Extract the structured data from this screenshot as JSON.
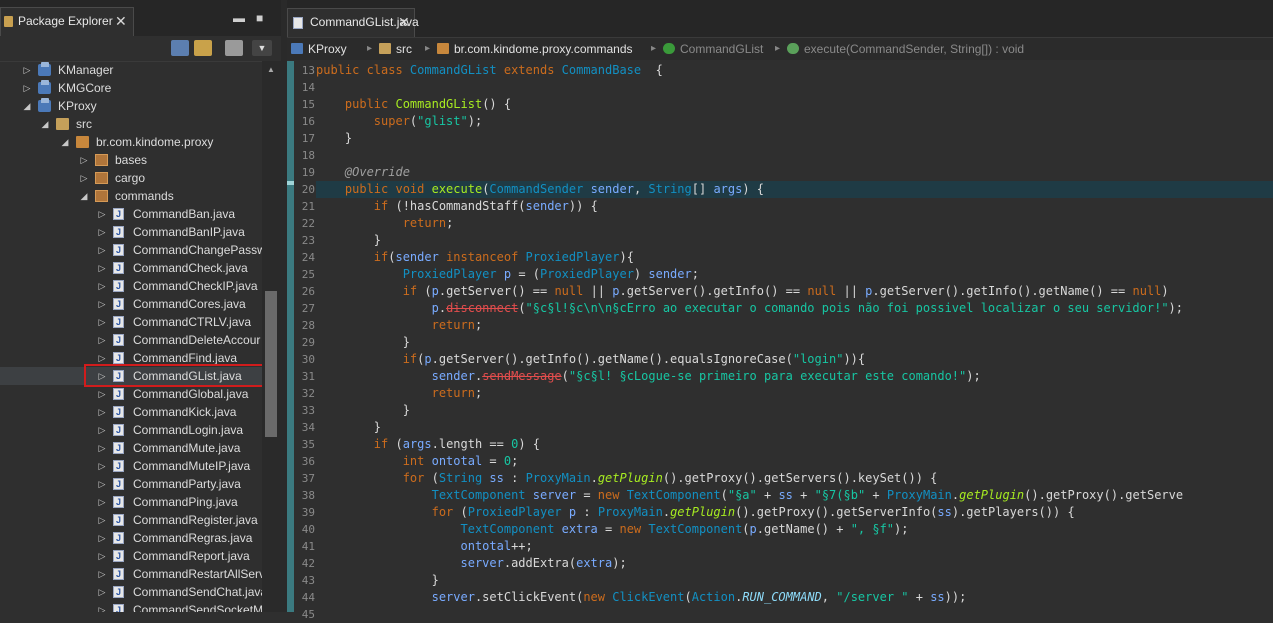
{
  "explorer": {
    "title": "Package Explorer",
    "close_symbol": "✕",
    "minimize_symbol": "▬",
    "maximize_symbol": "■",
    "toolbar": [
      "collapse-all-icon",
      "link-editor-icon",
      "focus-icon",
      "view-menu-icon"
    ],
    "tree": [
      {
        "label": "KManager",
        "level": 0,
        "state": "collapsed",
        "icon": "project-icon"
      },
      {
        "label": "KMGCore",
        "level": 0,
        "state": "collapsed",
        "icon": "project-icon"
      },
      {
        "label": "KProxy",
        "level": 0,
        "state": "expanded",
        "icon": "project-icon"
      },
      {
        "label": "src",
        "level": 1,
        "state": "expanded",
        "icon": "source-folder-icon"
      },
      {
        "label": "br.com.kindome.proxy",
        "level": 2,
        "state": "expanded",
        "icon": "package-icon"
      },
      {
        "label": "bases",
        "level": 3,
        "state": "collapsed",
        "icon": "package-icon"
      },
      {
        "label": "cargo",
        "level": 3,
        "state": "collapsed",
        "icon": "package-icon"
      },
      {
        "label": "commands",
        "level": 3,
        "state": "expanded",
        "icon": "package-icon"
      },
      {
        "label": "CommandBan.java",
        "level": 4,
        "state": "collapsed",
        "icon": "java-file-icon"
      },
      {
        "label": "CommandBanIP.java",
        "level": 4,
        "state": "collapsed",
        "icon": "java-file-icon"
      },
      {
        "label": "CommandChangePassw",
        "level": 4,
        "state": "collapsed",
        "icon": "java-file-icon"
      },
      {
        "label": "CommandCheck.java",
        "level": 4,
        "state": "collapsed",
        "icon": "java-file-icon"
      },
      {
        "label": "CommandCheckIP.java",
        "level": 4,
        "state": "collapsed",
        "icon": "java-file-icon"
      },
      {
        "label": "CommandCores.java",
        "level": 4,
        "state": "collapsed",
        "icon": "java-file-icon"
      },
      {
        "label": "CommandCTRLV.java",
        "level": 4,
        "state": "collapsed",
        "icon": "java-file-icon"
      },
      {
        "label": "CommandDeleteAccour",
        "level": 4,
        "state": "collapsed",
        "icon": "java-file-icon"
      },
      {
        "label": "CommandFind.java",
        "level": 4,
        "state": "collapsed",
        "icon": "java-file-icon"
      },
      {
        "label": "CommandGList.java",
        "level": 4,
        "state": "collapsed",
        "icon": "java-file-icon",
        "selected": true
      },
      {
        "label": "CommandGlobal.java",
        "level": 4,
        "state": "collapsed",
        "icon": "java-file-icon"
      },
      {
        "label": "CommandKick.java",
        "level": 4,
        "state": "collapsed",
        "icon": "java-file-icon"
      },
      {
        "label": "CommandLogin.java",
        "level": 4,
        "state": "collapsed",
        "icon": "java-file-icon"
      },
      {
        "label": "CommandMute.java",
        "level": 4,
        "state": "collapsed",
        "icon": "java-file-icon"
      },
      {
        "label": "CommandMuteIP.java",
        "level": 4,
        "state": "collapsed",
        "icon": "java-file-icon"
      },
      {
        "label": "CommandParty.java",
        "level": 4,
        "state": "collapsed",
        "icon": "java-file-icon"
      },
      {
        "label": "CommandPing.java",
        "level": 4,
        "state": "collapsed",
        "icon": "java-file-icon"
      },
      {
        "label": "CommandRegister.java",
        "level": 4,
        "state": "collapsed",
        "icon": "java-file-icon"
      },
      {
        "label": "CommandRegras.java",
        "level": 4,
        "state": "collapsed",
        "icon": "java-file-icon"
      },
      {
        "label": "CommandReport.java",
        "level": 4,
        "state": "collapsed",
        "icon": "java-file-icon"
      },
      {
        "label": "CommandRestartAllServ",
        "level": 4,
        "state": "collapsed",
        "icon": "java-file-icon"
      },
      {
        "label": "CommandSendChat.java",
        "level": 4,
        "state": "collapsed",
        "icon": "java-file-icon"
      },
      {
        "label": "CommandSendSocketM",
        "level": 4,
        "state": "collapsed",
        "icon": "java-file-icon"
      }
    ]
  },
  "editor": {
    "tab_label": "CommandGList.java",
    "close_symbol": "✕",
    "breadcrumb": [
      {
        "label": "KProxy",
        "icon": "project-icon"
      },
      {
        "label": "src",
        "icon": "source-folder-icon"
      },
      {
        "label": "br.com.kindome.proxy.commands",
        "icon": "package-icon"
      },
      {
        "label": "CommandGList",
        "icon": "class-icon"
      },
      {
        "label": "execute(CommandSender, String[]) : void",
        "icon": "method-icon"
      }
    ],
    "current_line": 20,
    "lines": [
      {
        "n": 13,
        "tokens": [
          [
            "kw",
            "public class "
          ],
          [
            "ty",
            "CommandGList "
          ],
          [
            "kw",
            "extends "
          ],
          [
            "ty",
            "CommandBase"
          ],
          [
            "",
            "  {"
          ]
        ]
      },
      {
        "n": 14,
        "tokens": []
      },
      {
        "n": 15,
        "tokens": [
          [
            "",
            "    "
          ],
          [
            "kw",
            "public "
          ],
          [
            "fn",
            "CommandGList"
          ],
          [
            "",
            "() {"
          ]
        ]
      },
      {
        "n": 16,
        "tokens": [
          [
            "",
            "        "
          ],
          [
            "kw",
            "super"
          ],
          [
            "",
            "("
          ],
          [
            "st",
            "\"glist\""
          ],
          [
            "",
            ");"
          ]
        ]
      },
      {
        "n": 17,
        "tokens": [
          [
            "",
            "    }"
          ]
        ]
      },
      {
        "n": 18,
        "tokens": []
      },
      {
        "n": 19,
        "tokens": [
          [
            "",
            "    "
          ],
          [
            "an",
            "@Override"
          ]
        ]
      },
      {
        "n": 20,
        "tokens": [
          [
            "",
            "    "
          ],
          [
            "kw",
            "public void "
          ],
          [
            "fn",
            "execute"
          ],
          [
            "",
            "("
          ],
          [
            "ty",
            "CommandSender "
          ],
          [
            "va",
            "sender"
          ],
          [
            "",
            ", "
          ],
          [
            "ty",
            "String"
          ],
          [
            "",
            "[] "
          ],
          [
            "va",
            "args"
          ],
          [
            "",
            ") {"
          ]
        ]
      },
      {
        "n": 21,
        "tokens": [
          [
            "",
            "        "
          ],
          [
            "kw",
            "if "
          ],
          [
            "",
            "(!hasCommandStaff("
          ],
          [
            "va",
            "sender"
          ],
          [
            "",
            ")) {"
          ]
        ]
      },
      {
        "n": 22,
        "tokens": [
          [
            "",
            "            "
          ],
          [
            "kw",
            "return"
          ],
          [
            "",
            ";"
          ]
        ]
      },
      {
        "n": 23,
        "tokens": [
          [
            "",
            "        }"
          ]
        ]
      },
      {
        "n": 24,
        "tokens": [
          [
            "",
            "        "
          ],
          [
            "kw",
            "if"
          ],
          [
            "",
            "("
          ],
          [
            "va",
            "sender "
          ],
          [
            "kw",
            "instanceof "
          ],
          [
            "ty",
            "ProxiedPlayer"
          ],
          [
            "",
            "){"
          ]
        ]
      },
      {
        "n": 25,
        "tokens": [
          [
            "",
            "            "
          ],
          [
            "ty",
            "ProxiedPlayer "
          ],
          [
            "va",
            "p"
          ],
          [
            "",
            " = ("
          ],
          [
            "ty",
            "ProxiedPlayer"
          ],
          [
            "",
            ") "
          ],
          [
            "va",
            "sender"
          ],
          [
            "",
            ";"
          ]
        ]
      },
      {
        "n": 26,
        "tokens": [
          [
            "",
            "            "
          ],
          [
            "kw",
            "if "
          ],
          [
            "",
            "("
          ],
          [
            "va",
            "p"
          ],
          [
            "",
            ".getServer() == "
          ],
          [
            "kw",
            "null"
          ],
          [
            "",
            " || "
          ],
          [
            "va",
            "p"
          ],
          [
            "",
            ".getServer().getInfo() == "
          ],
          [
            "kw",
            "null"
          ],
          [
            "",
            " || "
          ],
          [
            "va",
            "p"
          ],
          [
            "",
            ".getServer().getInfo().getName() == "
          ],
          [
            "kw",
            "null"
          ],
          [
            "",
            ")"
          ]
        ]
      },
      {
        "n": 27,
        "tokens": [
          [
            "",
            "                "
          ],
          [
            "va",
            "p"
          ],
          [
            "",
            "."
          ],
          [
            "de",
            "disconnect"
          ],
          [
            "",
            "("
          ],
          [
            "st",
            "\"§c§l!§c\\n\\n§cErro ao executar o comando pois não foi possivel localizar o seu servidor!\""
          ],
          [
            "",
            ");"
          ]
        ]
      },
      {
        "n": 28,
        "tokens": [
          [
            "",
            "                "
          ],
          [
            "kw",
            "return"
          ],
          [
            "",
            ";"
          ]
        ]
      },
      {
        "n": 29,
        "tokens": [
          [
            "",
            "            }"
          ]
        ]
      },
      {
        "n": 30,
        "tokens": [
          [
            "",
            "            "
          ],
          [
            "kw",
            "if"
          ],
          [
            "",
            "("
          ],
          [
            "va",
            "p"
          ],
          [
            "",
            ".getServer().getInfo().getName().equalsIgnoreCase("
          ],
          [
            "st",
            "\"login\""
          ],
          [
            "",
            "))"
          ],
          [
            "",
            "{"
          ]
        ]
      },
      {
        "n": 31,
        "tokens": [
          [
            "",
            "                "
          ],
          [
            "va",
            "sender"
          ],
          [
            "",
            "."
          ],
          [
            "de",
            "sendMessage"
          ],
          [
            "",
            "("
          ],
          [
            "st",
            "\"§c§l! §cLogue-se primeiro para executar este comando!\""
          ],
          [
            "",
            ");"
          ]
        ]
      },
      {
        "n": 32,
        "tokens": [
          [
            "",
            "                "
          ],
          [
            "kw",
            "return"
          ],
          [
            "",
            ";"
          ]
        ]
      },
      {
        "n": 33,
        "tokens": [
          [
            "",
            "            }"
          ]
        ]
      },
      {
        "n": 34,
        "tokens": [
          [
            "",
            "        }"
          ]
        ]
      },
      {
        "n": 35,
        "tokens": [
          [
            "",
            "        "
          ],
          [
            "kw",
            "if "
          ],
          [
            "",
            "("
          ],
          [
            "va",
            "args"
          ],
          [
            "",
            ".length == "
          ],
          [
            "st",
            "0"
          ],
          [
            "",
            ") {"
          ]
        ]
      },
      {
        "n": 36,
        "tokens": [
          [
            "",
            "            "
          ],
          [
            "kw",
            "int "
          ],
          [
            "va",
            "ontotal"
          ],
          [
            "",
            " = "
          ],
          [
            "st",
            "0"
          ],
          [
            "",
            ";"
          ]
        ]
      },
      {
        "n": 37,
        "tokens": [
          [
            "",
            "            "
          ],
          [
            "kw",
            "for "
          ],
          [
            "",
            "("
          ],
          [
            "ty",
            "String "
          ],
          [
            "va",
            "ss"
          ],
          [
            "",
            " : "
          ],
          [
            "ty",
            "ProxyMain"
          ],
          [
            "",
            "."
          ],
          [
            "it",
            "getPlugin"
          ],
          [
            "",
            "().getProxy().getServers().keySet()) {"
          ]
        ]
      },
      {
        "n": 38,
        "tokens": [
          [
            "",
            "                "
          ],
          [
            "ty",
            "TextComponent "
          ],
          [
            "va",
            "server"
          ],
          [
            "",
            " = "
          ],
          [
            "kw",
            "new "
          ],
          [
            "ty",
            "TextComponent"
          ],
          [
            "",
            "("
          ],
          [
            "st",
            "\"§a\""
          ],
          [
            "",
            " + "
          ],
          [
            "va",
            "ss"
          ],
          [
            "",
            " + "
          ],
          [
            "st",
            "\"§7(§b\""
          ],
          [
            "",
            " + "
          ],
          [
            "ty",
            "ProxyMain"
          ],
          [
            "",
            "."
          ],
          [
            "it",
            "getPlugin"
          ],
          [
            "",
            "().getProxy().getServe"
          ]
        ]
      },
      {
        "n": 39,
        "tokens": [
          [
            "",
            "                "
          ],
          [
            "kw",
            "for "
          ],
          [
            "",
            "("
          ],
          [
            "ty",
            "ProxiedPlayer "
          ],
          [
            "va",
            "p"
          ],
          [
            "",
            " : "
          ],
          [
            "ty",
            "ProxyMain"
          ],
          [
            "",
            "."
          ],
          [
            "it",
            "getPlugin"
          ],
          [
            "",
            "().getProxy().getServerInfo("
          ],
          [
            "va",
            "ss"
          ],
          [
            "",
            ").getPlayers()) {"
          ]
        ]
      },
      {
        "n": 40,
        "tokens": [
          [
            "",
            "                    "
          ],
          [
            "ty",
            "TextComponent "
          ],
          [
            "va",
            "extra"
          ],
          [
            "",
            " = "
          ],
          [
            "kw",
            "new "
          ],
          [
            "ty",
            "TextComponent"
          ],
          [
            "",
            "("
          ],
          [
            "va",
            "p"
          ],
          [
            "",
            ".getName() + "
          ],
          [
            "st",
            "\", §f\""
          ],
          [
            "",
            ");"
          ]
        ]
      },
      {
        "n": 41,
        "tokens": [
          [
            "",
            "                    "
          ],
          [
            "va",
            "ontotal"
          ],
          [
            "",
            "++;"
          ]
        ]
      },
      {
        "n": 42,
        "tokens": [
          [
            "",
            "                    "
          ],
          [
            "va",
            "server"
          ],
          [
            "",
            ".addExtra("
          ],
          [
            "va",
            "extra"
          ],
          [
            "",
            ");"
          ]
        ]
      },
      {
        "n": 43,
        "tokens": [
          [
            "",
            "                }"
          ]
        ]
      },
      {
        "n": 44,
        "tokens": [
          [
            "",
            "                "
          ],
          [
            "va",
            "server"
          ],
          [
            "",
            ".setClickEvent("
          ],
          [
            "kw",
            "new "
          ],
          [
            "ty",
            "ClickEvent"
          ],
          [
            "",
            "("
          ],
          [
            "ty",
            "Action"
          ],
          [
            "",
            "."
          ],
          [
            "fi",
            "RUN_COMMAND"
          ],
          [
            "",
            ", "
          ],
          [
            "st",
            "\"/server \""
          ],
          [
            "",
            " + "
          ],
          [
            "va",
            "ss"
          ],
          [
            "",
            "));"
          ]
        ]
      },
      {
        "n": 45,
        "tokens": []
      }
    ]
  },
  "colors": {
    "background": "#2f2f2f",
    "keyword": "#cc6c1d",
    "type": "#1290c3",
    "method": "#a7ec21",
    "string": "#17c6a3",
    "current_line": "#1f3b45",
    "selection_outline": "#d11c1c"
  }
}
